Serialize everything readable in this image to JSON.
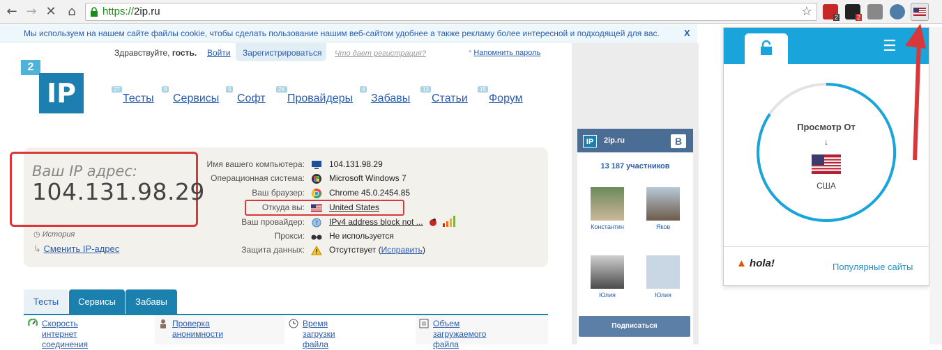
{
  "browser": {
    "url_scheme": "https://",
    "url_host": "2ip.ru",
    "ext_badge_1": "2",
    "ext_badge_2": "2"
  },
  "cookie": {
    "text": "Мы используем на нашем сайте файлы cookie, чтобы сделать пользование нашим веб-сайтом удобнее а также рекламу более интересной и подходящей для вас.",
    "close": "X"
  },
  "login": {
    "greeting_prefix": "Здравствуйте,",
    "greeting_name": "гость.",
    "signin": "Войти",
    "register": "Зарегистрироваться",
    "why": "Что дает регистрация?",
    "remind_mark": "*",
    "remind": "Напомнить пароль"
  },
  "logo": {
    "small": "2",
    "big": "IP"
  },
  "nav": [
    {
      "badge": "27",
      "label": "Тесты"
    },
    {
      "badge": "9",
      "label": "Сервисы"
    },
    {
      "badge": "5",
      "label": "Софт"
    },
    {
      "badge": "2K",
      "label": "Провайдеры"
    },
    {
      "badge": "4",
      "label": "Забавы"
    },
    {
      "badge": "13",
      "label": "Статьи"
    },
    {
      "badge": "15",
      "label": "Форум"
    }
  ],
  "ip": {
    "label": "Ваш IP адрес:",
    "value": "104.131.98.29",
    "history": "История",
    "change": "Сменить IP-адрес"
  },
  "info": [
    {
      "key": "Имя вашего компьютера:",
      "icon": "computer-icon",
      "value": "104.131.98.29"
    },
    {
      "key": "Операционная система:",
      "icon": "windows-icon",
      "value": "Microsoft Windows 7"
    },
    {
      "key": "Ваш браузер:",
      "icon": "chrome-icon",
      "value": "Chrome 45.0.2454.85"
    },
    {
      "key": "Откуда вы:",
      "icon": "us-flag-icon",
      "value": "United States"
    },
    {
      "key": "Ваш провайдер:",
      "icon": "provider-icon",
      "value": "IPv4 address block not ..."
    },
    {
      "key": "Прокси:",
      "icon": "glasses-icon",
      "value": "Не используется"
    },
    {
      "key": "Защита данных:",
      "icon": "warning-icon",
      "value_prefix": "Отсутствует (",
      "value_link": "Исправить",
      "value_suffix": ")"
    }
  ],
  "tabs": [
    "Тесты",
    "Сервисы",
    "Забавы"
  ],
  "services": [
    {
      "icon": "speed-icon",
      "line1": "Скорость интернет",
      "line2": "соединения"
    },
    {
      "icon": "anonymity-icon",
      "line1": "Проверка анонимности",
      "line2": ""
    },
    {
      "icon": "clock-icon",
      "line1": "Время загрузки файла",
      "line2": ""
    },
    {
      "icon": "size-icon",
      "line1": "Объем загружаемого",
      "line2": "файла"
    }
  ],
  "vk": {
    "title": "2ip.ru",
    "logo": "IP",
    "vk_letter": "B",
    "count": "13 187 участников",
    "members": [
      "Константин",
      "Яков",
      "Юлия",
      "Юлия"
    ],
    "subscribe": "Подписаться"
  },
  "hola": {
    "view_from": "Просмотр От",
    "arrow": "↓",
    "country": "США",
    "logo": "hola!",
    "popular": "Популярные сайты"
  },
  "colors": {
    "accent": "#1b80ad",
    "hola_blue": "#19a4dc",
    "highlight_red": "#d9383a",
    "link": "#2a5db0"
  }
}
